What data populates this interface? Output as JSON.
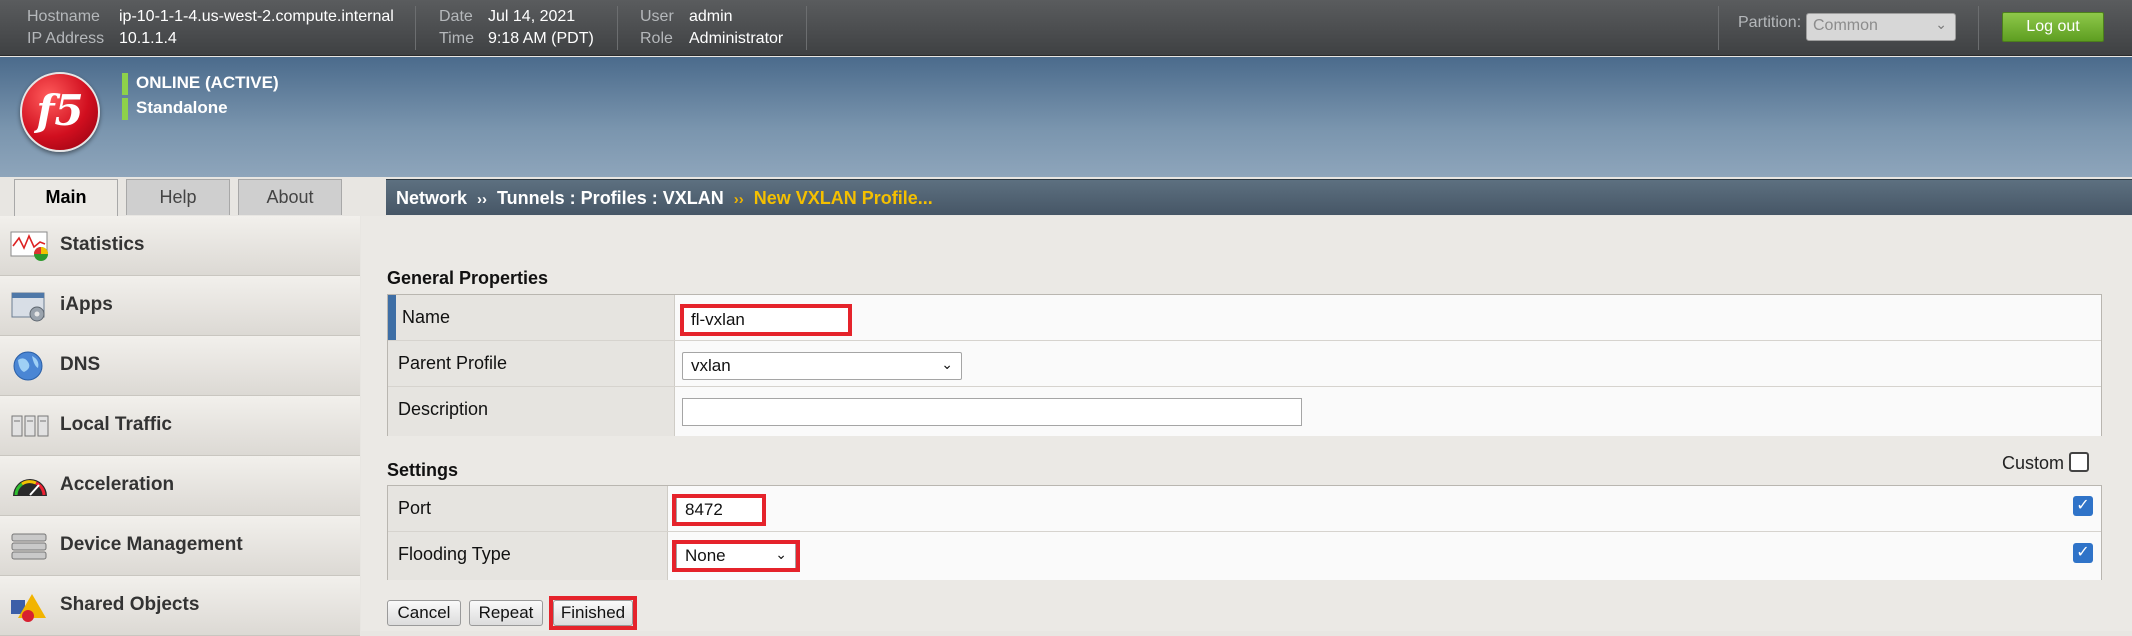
{
  "topbar": {
    "hostname_label": "Hostname",
    "hostname": "ip-10-1-1-4.us-west-2.compute.internal",
    "ip_label": "IP Address",
    "ip": "10.1.1.4",
    "date_label": "Date",
    "date": "Jul 14, 2021",
    "time_label": "Time",
    "time": "9:18 AM (PDT)",
    "user_label": "User",
    "user": "admin",
    "role_label": "Role",
    "role": "Administrator",
    "partition_label": "Partition:",
    "partition_value": "Common",
    "logout_label": "Log out"
  },
  "banner": {
    "logo_text": "f5",
    "status_primary": "ONLINE (ACTIVE)",
    "status_secondary": "Standalone"
  },
  "tabs": [
    {
      "label": "Main",
      "active": true
    },
    {
      "label": "Help",
      "active": false
    },
    {
      "label": "About",
      "active": false
    }
  ],
  "breadcrumb": {
    "items": [
      "Network",
      "Tunnels : Profiles : VXLAN"
    ],
    "separator": "››",
    "current": "New VXLAN Profile..."
  },
  "sidebar": {
    "items": [
      {
        "label": "Statistics",
        "icon": "statistics-icon"
      },
      {
        "label": "iApps",
        "icon": "iapps-icon"
      },
      {
        "label": "DNS",
        "icon": "dns-globe-icon"
      },
      {
        "label": "Local Traffic",
        "icon": "local-traffic-icon"
      },
      {
        "label": "Acceleration",
        "icon": "acceleration-gauge-icon"
      },
      {
        "label": "Device Management",
        "icon": "device-management-icon"
      },
      {
        "label": "Shared Objects",
        "icon": "shared-objects-icon"
      }
    ]
  },
  "general": {
    "title": "General Properties",
    "name_label": "Name",
    "name_value": "fl-vxlan",
    "parent_label": "Parent Profile",
    "parent_value": "vxlan",
    "description_label": "Description",
    "description_value": ""
  },
  "settings": {
    "title": "Settings",
    "custom_label": "Custom",
    "port_label": "Port",
    "port_value": "8472",
    "flooding_label": "Flooding Type",
    "flooding_value": "None"
  },
  "buttons": {
    "cancel": "Cancel",
    "repeat": "Repeat",
    "finished": "Finished"
  },
  "colors": {
    "highlight": "#e5232b",
    "accent": "#3e6ea5",
    "breadcrumb_current": "#f5c000",
    "online": "#8ed14a"
  }
}
